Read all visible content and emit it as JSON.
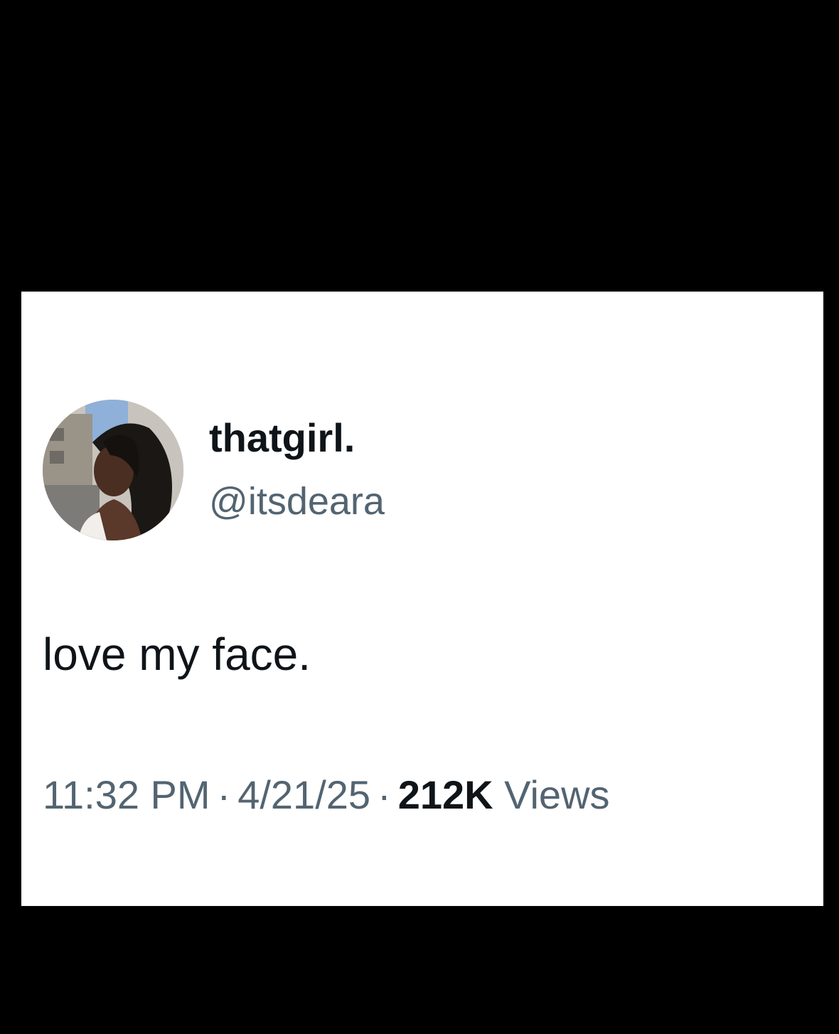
{
  "tweet": {
    "display_name": "thatgirl.",
    "handle": "@itsdeara",
    "text": "love my face.",
    "time": "11:32 PM",
    "separator": "·",
    "date": "4/21/25",
    "views_count": "212K",
    "views_label": "Views",
    "avatar_icon": "profile-photo"
  },
  "colors": {
    "background": "#000000",
    "card": "#ffffff",
    "primary_text": "#0f1419",
    "secondary_text": "#536471"
  }
}
